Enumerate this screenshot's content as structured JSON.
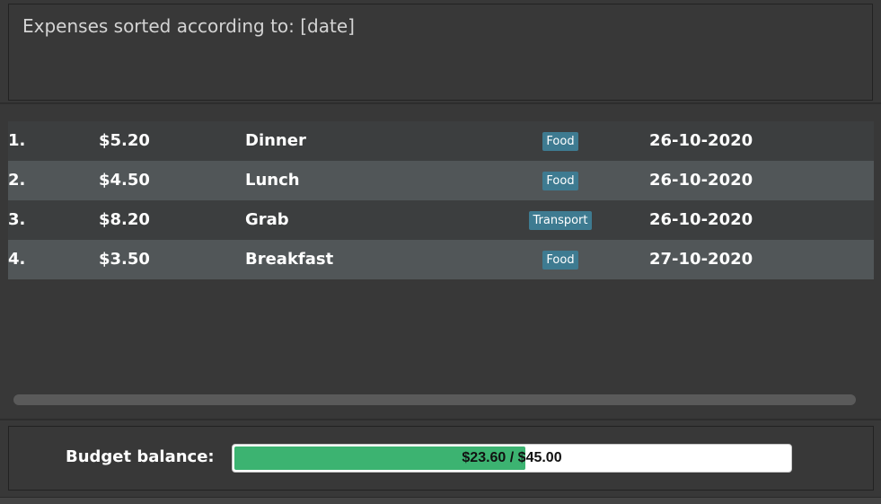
{
  "result_display": {
    "text": "Expenses sorted according to: [date]"
  },
  "expenses": [
    {
      "index": "1.",
      "amount": "$5.20",
      "description": "Dinner",
      "tag": "Food",
      "date": "26-10-2020"
    },
    {
      "index": "2.",
      "amount": "$4.50",
      "description": "Lunch",
      "tag": "Food",
      "date": "26-10-2020"
    },
    {
      "index": "3.",
      "amount": "$8.20",
      "description": "Grab",
      "tag": "Transport",
      "date": "26-10-2020"
    },
    {
      "index": "4.",
      "amount": "$3.50",
      "description": "Breakfast",
      "tag": "Food",
      "date": "27-10-2020"
    }
  ],
  "budget": {
    "label": "Budget balance:",
    "progress_text": "$23.60 / $45.00",
    "progress_fraction": 0.5244
  },
  "colors": {
    "tag_background": "#3e7b91",
    "progress_fill": "#3cb371"
  }
}
